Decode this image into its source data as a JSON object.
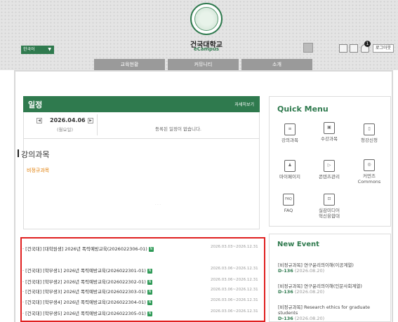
{
  "header": {
    "brand_name": "건국대학교",
    "brand_sub": "eCampus",
    "language": "한국어",
    "notification_count": "1",
    "logout_label": "로그아웃"
  },
  "nav": {
    "tabs": [
      {
        "label": "교육현황"
      },
      {
        "label": "커뮤니티"
      },
      {
        "label": "소개"
      }
    ]
  },
  "schedule": {
    "title": "일정",
    "more_label": "자세히보기",
    "date": "2026.04.06",
    "weekday": "(월요일)",
    "empty_message": "등록된 일정이 없습니다.",
    "prev_label": "◀",
    "next_label": "▶"
  },
  "lectures": {
    "title": "강의과목",
    "subtitle": "비정규과목"
  },
  "courses": [
    {
      "name": "[건국대] [대학원생] 2026년 폭력예방교육(2026022306-01)",
      "badge": "N",
      "period": "2026.03.03~2026.12.31"
    },
    {
      "name": "[건국대] [학부생1] 2026년 폭력예방교육(2026022301-01)",
      "badge": "N",
      "period": "2026.03.06~2026.12.31"
    },
    {
      "name": "[건국대] [학부생2] 2026년 폭력예방교육(2026022302-01)",
      "badge": "N",
      "period": "2026.03.06~2026.12.31"
    },
    {
      "name": "[건국대] [학부생3] 2026년 폭력예방교육(2026022303-01)",
      "badge": "N",
      "period": "2026.03.06~2026.12.31"
    },
    {
      "name": "[건국대] [학부생4] 2026년 폭력예방교육(2026022304-01)",
      "badge": "N",
      "period": "2026.03.06~2026.12.31"
    },
    {
      "name": "[건국대] [학부생5] 2026년 폭력예방교육(2026022305-01)",
      "badge": "N",
      "period": "2026.03.06~2026.12.31"
    }
  ],
  "quick_menu": {
    "title": "Quick Menu",
    "items": [
      {
        "label": "강의과목",
        "icon": "document-icon"
      },
      {
        "label": "수강과목",
        "icon": "id-card-icon"
      },
      {
        "label": "청강신청",
        "icon": "bookmark-icon"
      },
      {
        "label": "마이페이지",
        "icon": "profile-icon"
      },
      {
        "label": "콘텐츠관리",
        "icon": "play-file-icon"
      },
      {
        "label": "커먼즈\nCommons",
        "icon": "camera-icon"
      },
      {
        "label": "FAQ",
        "icon": "faq-icon"
      },
      {
        "label": "실감미디어\n혁신융합대",
        "icon": "media-icon"
      }
    ],
    "icon_glyphs": {
      "faq": "FAQ"
    }
  },
  "events": {
    "title": "New Event",
    "items": [
      {
        "title": "[비정규과목] 연구윤리의이해(이공계열)",
        "dday": "D-136",
        "date": "(2026.08.20)"
      },
      {
        "title": "[비정규과목] 연구윤리의이해(인문사회계열)",
        "dday": "D-136",
        "date": "(2026.08.20)"
      },
      {
        "title": "[비정규과목] Research ethics for graduate students",
        "dday": "D-136",
        "date": "(2026.08.20)"
      }
    ]
  },
  "colors": {
    "brand_green": "#2f7a4e",
    "highlight_red": "#e02020",
    "accent_orange": "#e07b00"
  }
}
